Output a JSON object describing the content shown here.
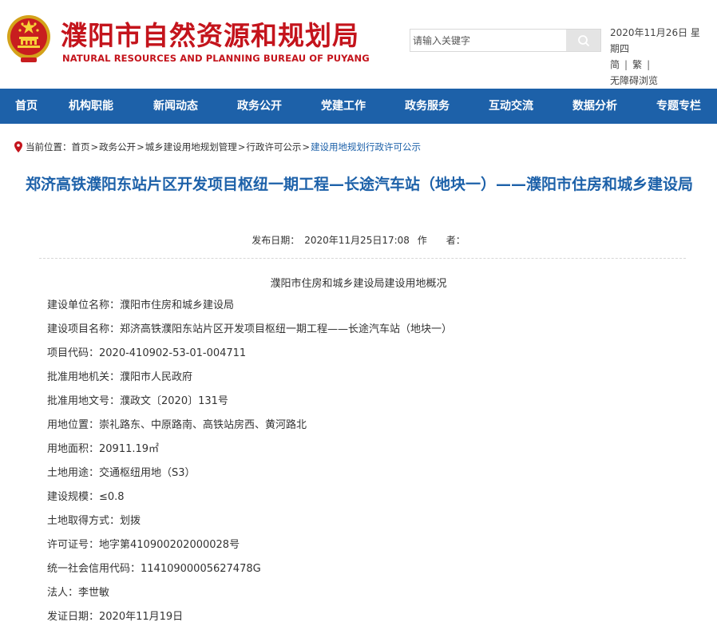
{
  "header": {
    "site_title_cn": "濮阳市自然资源和规划局",
    "site_title_en": "NATURAL RESOURCES AND PLANNING BUREAU OF PUYANG",
    "emblem_icon": "national-emblem-icon",
    "search": {
      "placeholder": "请输入关键字",
      "button_icon": "search-icon"
    },
    "date_line1": "2020年11月26日  星",
    "date_line2": "期四",
    "lang": {
      "simplified": "简",
      "traditional": "繁",
      "sep": "|"
    },
    "accessibility": "无障碍浏览"
  },
  "nav": {
    "items": [
      {
        "label": "首页"
      },
      {
        "label": "机构职能"
      },
      {
        "label": "新闻动态"
      },
      {
        "label": "政务公开"
      },
      {
        "label": "党建工作"
      },
      {
        "label": "政务服务"
      },
      {
        "label": "互动交流"
      },
      {
        "label": "数据分析"
      },
      {
        "label": "专题专栏"
      }
    ],
    "color": "#1d61a9"
  },
  "breadcrumb": {
    "prefix": "当前位置：",
    "items": [
      "首页",
      "政务公开",
      "城乡建设用地规划管理",
      "行政许可公示",
      "建设用地规划行政许可公示"
    ],
    "separator": ">",
    "icon": "location-pin-icon"
  },
  "article": {
    "title": "郑济高铁濮阳东站片区开发项目枢纽一期工程—长途汽车站（地块一）——濮阳市住房和城乡建设局",
    "publish_date_label": "发布日期：",
    "publish_date": "2020年11月25日17:08",
    "author_label": "作　　者：",
    "subtitle": "濮阳市住房和城乡建设局建设用地概况",
    "fields": [
      {
        "label": "建设单位名称：",
        "value": "濮阳市住房和城乡建设局"
      },
      {
        "label": "建设项目名称：",
        "value": "郑济高铁濮阳东站片区开发项目枢纽一期工程——长途汽车站（地块一）"
      },
      {
        "label": "项目代码：",
        "value": "2020-410902-53-01-004711"
      },
      {
        "label": "批准用地机关：",
        "value": "濮阳市人民政府"
      },
      {
        "label": "批准用地文号：",
        "value": "濮政文〔2020〕131号"
      },
      {
        "label": "用地位置：",
        "value": "崇礼路东、中原路南、高铁站房西、黄河路北"
      },
      {
        "label": "用地面积：",
        "value": "20911.19㎡"
      },
      {
        "label": "土地用途：",
        "value": "交通枢纽用地（S3）"
      },
      {
        "label": "建设规模：",
        "value": "≤0.8"
      },
      {
        "label": "土地取得方式：",
        "value": "划拨"
      },
      {
        "label": "许可证号：",
        "value": "地字第410900202000028号"
      },
      {
        "label": "统一社会信用代码：",
        "value": "11410900005627478G"
      },
      {
        "label": "法人：",
        "value": "李世敏"
      },
      {
        "label": "发证日期：",
        "value": "2020年11月19日"
      }
    ]
  },
  "colors": {
    "brand_red": "#c4141c",
    "brand_blue": "#1d61a9"
  }
}
